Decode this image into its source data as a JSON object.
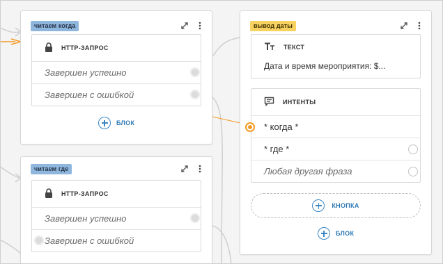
{
  "cards": {
    "read_when": {
      "tag": "читаем когда",
      "block_label": "HTTP-ЗАПРОС",
      "rows": [
        "Завершен успешно",
        "Завершен с ошибкой"
      ],
      "add_block": "БЛОК"
    },
    "read_where": {
      "tag": "читаем где",
      "block_label": "HTTP-ЗАПРОС",
      "rows": [
        "Завершен успешно",
        "Завершен с ошибкой"
      ]
    },
    "output_date": {
      "tag": "вывод даты",
      "text_block_label": "ТЕКСТ",
      "text_value": "Дата и время мероприятия: $...",
      "intents_label": "ИНТЕНТЫ",
      "intents": [
        "* когда *",
        "* где *",
        "Любая другая фраза"
      ],
      "add_button": "КНОПКА",
      "add_block": "БЛОК"
    }
  },
  "icons": [
    "expand-icon",
    "more-vertical-icon",
    "lock-icon",
    "text-type-icon",
    "chat-intents-icon",
    "plus-circle-icon"
  ],
  "colors": {
    "link": "#2d79b5",
    "tag_blue": "#8fb7dd",
    "tag_yellow": "#f7d260",
    "connector": "#f59a23"
  }
}
